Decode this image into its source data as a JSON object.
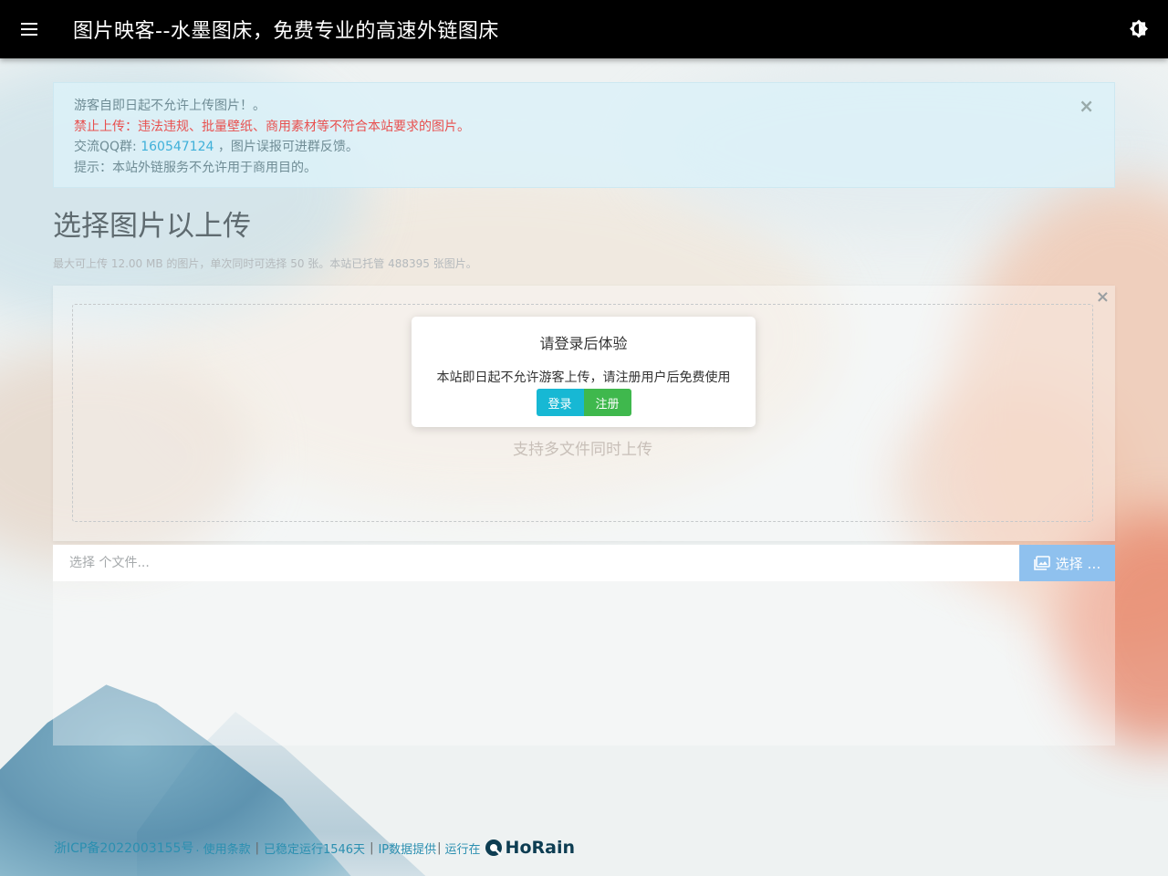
{
  "header": {
    "title": "图片映客--水墨图床，免费专业的高速外链图床"
  },
  "alert": {
    "line1": "游客自即日起不允许上传图片！。",
    "line2": "禁止上传：违法违规、批量壁纸、商用素材等不符合本站要求的图片。",
    "line3_prefix": "交流QQ群: ",
    "line3_qq": "160547124",
    "line3_suffix": " ，图片误报可进群反馈。",
    "line4": "提示：本站外链服务不允许用于商用目的。",
    "close": "×"
  },
  "upload": {
    "heading": "选择图片以上传",
    "note": "最大可上传 12.00 MB 的图片，单次同时可选择 50 张。本站已托管 488395 张图片。",
    "drop_hint": "支持多文件同时上传",
    "close": "×",
    "file_placeholder": "选择 个文件...",
    "browse_label": "选择 …"
  },
  "modal": {
    "title": "请登录后体验",
    "text": "本站即日起不允许游客上传，请注册用户后免费使用",
    "login": "登录",
    "register": "注册"
  },
  "footer": {
    "icp": "浙ICP备2022003155号",
    "dot": ".",
    "terms": "使用条款",
    "uptime": "已稳定运行1546天",
    "ip": "IP数据提供",
    "powered": "运行在",
    "brand": "HoRain",
    "sep": "|"
  },
  "colors": {
    "accent": "#17b8d4",
    "register": "#3fb84d",
    "browse": "#8fc1ee",
    "warning": "#e8504f"
  }
}
